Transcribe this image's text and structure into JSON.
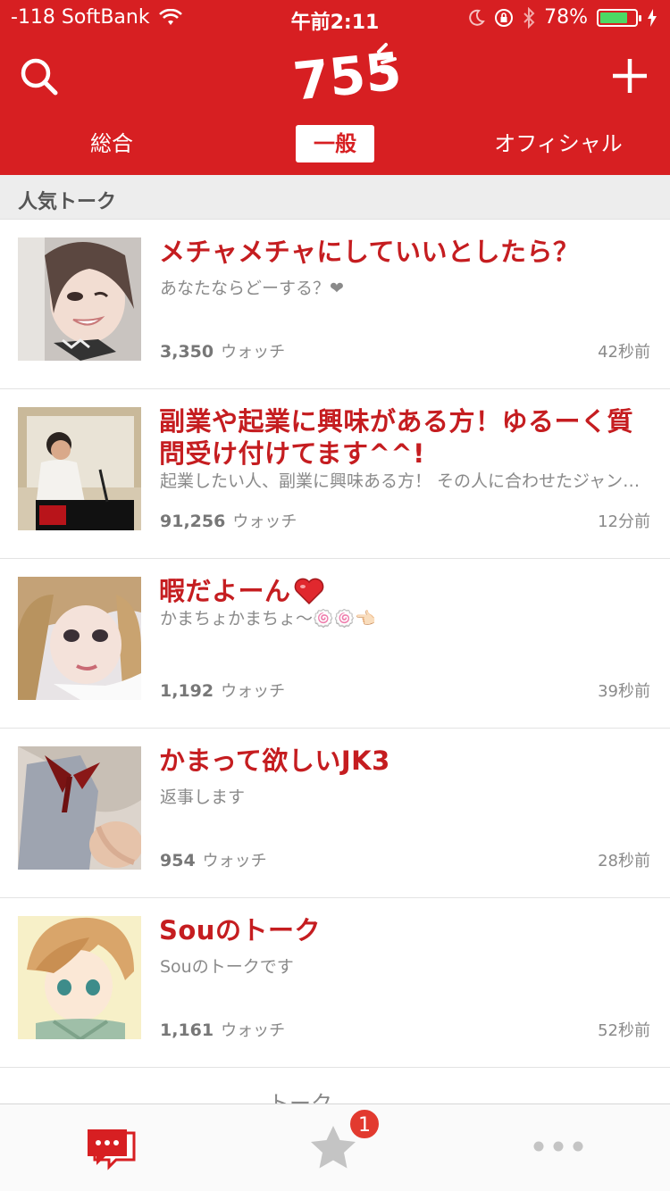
{
  "status_bar": {
    "carrier": "-118 SoftBank",
    "time": "午前2:11",
    "battery_percent": "78%",
    "battery_level": 0.78,
    "icons": [
      "wifi-icon",
      "moon-icon",
      "rotation-lock-icon",
      "bluetooth-icon",
      "battery-icon",
      "charging-icon"
    ]
  },
  "nav": {
    "logo_text": "755",
    "tabs": [
      {
        "label": "総合",
        "active": false
      },
      {
        "label": "一般",
        "active": true
      },
      {
        "label": "オフィシャル",
        "active": false
      }
    ]
  },
  "section": {
    "title": "人気トーク"
  },
  "talks": [
    {
      "title": "メチャメチャにしていいとしたら？",
      "subtitle": "あなたならどーする？❤",
      "watch_count": "3,350",
      "watch_label": "ウォッチ",
      "time_ago": "42秒前"
    },
    {
      "title": "副業や起業に興味がある方！ゆるーく質問受け付けてます^^!",
      "subtitle": "起業したい人、副業に興味ある方！ その人に合わせたジャンルで...",
      "watch_count": "91,256",
      "watch_label": "ウォッチ",
      "time_ago": "12分前"
    },
    {
      "title": "暇だよーん",
      "subtitle": "かまちょかまちょ〜🍥🍥👈🏻",
      "watch_count": "1,192",
      "watch_label": "ウォッチ",
      "time_ago": "39秒前"
    },
    {
      "title": "かまって欲しいJK3",
      "subtitle": "返事します",
      "watch_count": "954",
      "watch_label": "ウォッチ",
      "time_ago": "28秒前"
    },
    {
      "title": "Souのトーク",
      "subtitle": "Souのトークです",
      "watch_count": "1,161",
      "watch_label": "ウォッチ",
      "time_ago": "52秒前"
    }
  ],
  "footer_hint": "トーク",
  "tabbar": {
    "items": [
      {
        "icon": "chat-bubbles-icon",
        "active": true
      },
      {
        "icon": "star-icon",
        "active": false,
        "badge": "1"
      },
      {
        "icon": "more-dots-icon",
        "active": false
      }
    ]
  },
  "colors": {
    "brand_red": "#d71f22",
    "title_red": "#c51d20",
    "badge_red": "#e23a2f"
  }
}
